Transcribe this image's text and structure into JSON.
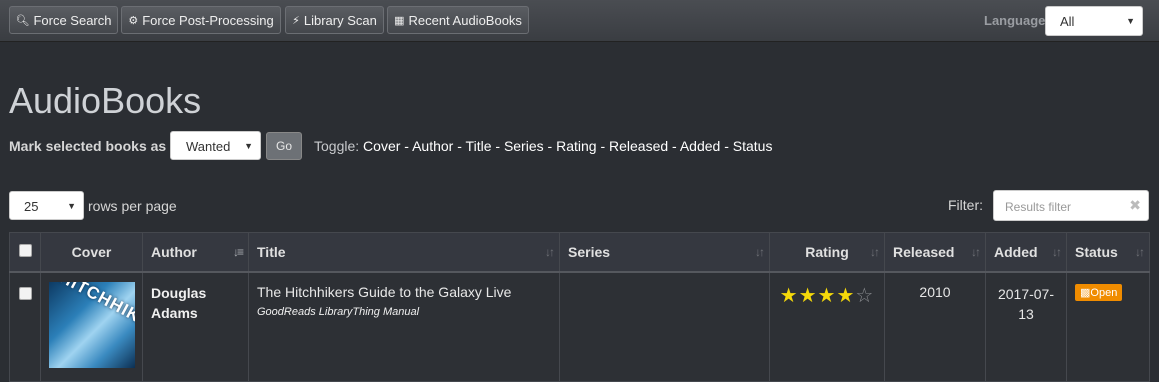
{
  "toolbar": {
    "force_search": "Force Search",
    "force_post": "Force Post-Processing",
    "library_scan": "Library Scan",
    "recent": "Recent AudioBooks",
    "language_label": "Language",
    "language_value": "All"
  },
  "page": {
    "title": "AudioBooks",
    "mark_label": "Mark selected books as",
    "mark_value": "Wanted",
    "go_label": "Go",
    "toggle_label": "Toggle:",
    "toggle_items": [
      "Cover",
      "Author",
      "Title",
      "Series",
      "Rating",
      "Released",
      "Added",
      "Status"
    ],
    "rows_value": "25",
    "rows_label": "rows per page",
    "filter_label": "Filter:",
    "filter_placeholder": "Results filter"
  },
  "table": {
    "headers": [
      "Cover",
      "Author",
      "Title",
      "Series",
      "Rating",
      "Released",
      "Added",
      "Status"
    ],
    "rows": [
      {
        "cover_text": "HITCHHIKERS",
        "author": "Douglas Adams",
        "title": "The Hitchhikers Guide to the Galaxy Live",
        "links": "GoodReads LibraryThing Manual",
        "series": "",
        "rating": 4,
        "rating_max": 5,
        "released": "2010",
        "added": "2017-07-13",
        "status": "Open"
      }
    ]
  },
  "colors": {
    "background": "#2b2e33",
    "status_badge": "#f08c00",
    "star": "#f5d90a"
  }
}
